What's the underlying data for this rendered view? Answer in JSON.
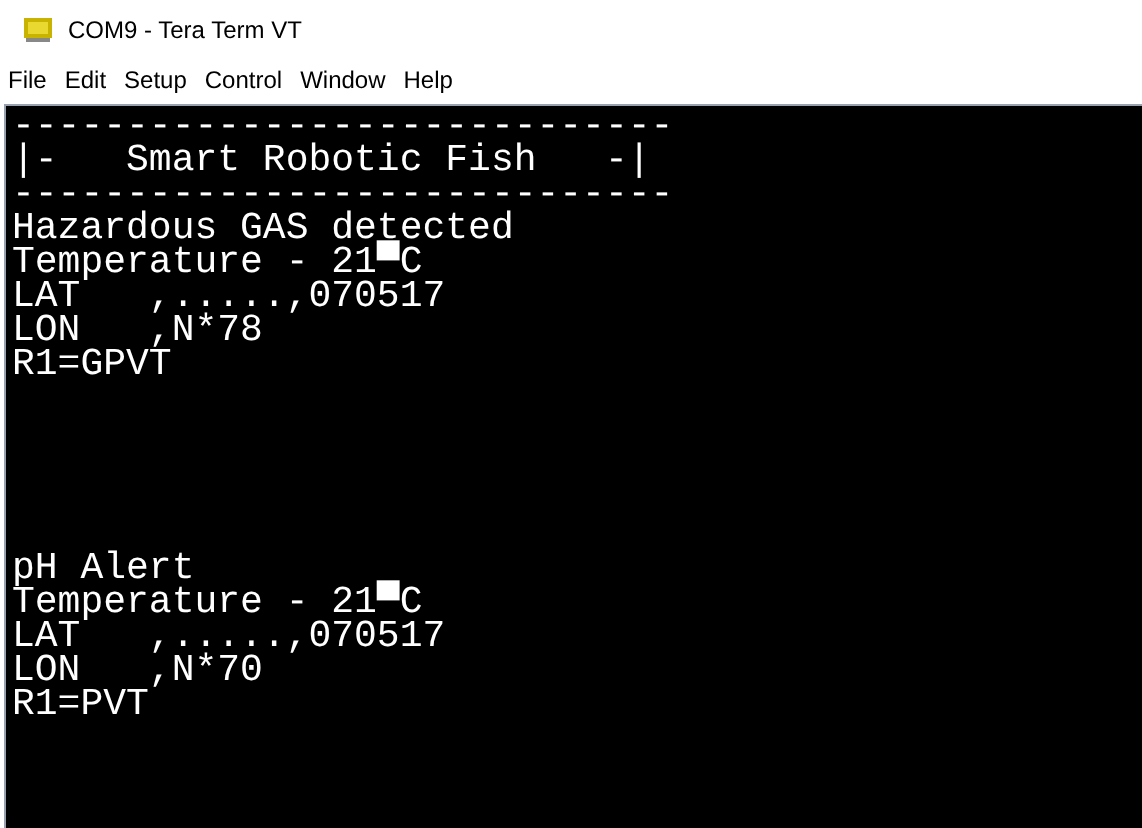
{
  "window": {
    "title": "COM9 - Tera Term VT"
  },
  "menu": [
    "File",
    "Edit",
    "Setup",
    "Control",
    "Window",
    "Help"
  ],
  "terminal": {
    "blocks": [
      {
        "lines": [
          "-----------------------------",
          "|-   Smart Robotic Fish   -|",
          "-----------------------------",
          "Hazardous GAS detected",
          "Temperature - 21▀C",
          "LAT   ,.....,070517",
          "LON   ,N*78",
          "R1=GPVT"
        ]
      },
      {
        "lines": [
          "pH Alert",
          "Temperature - 21▀C",
          "LAT   ,.....,070517",
          "LON   ,N*70",
          "R1=PVT"
        ]
      }
    ]
  }
}
